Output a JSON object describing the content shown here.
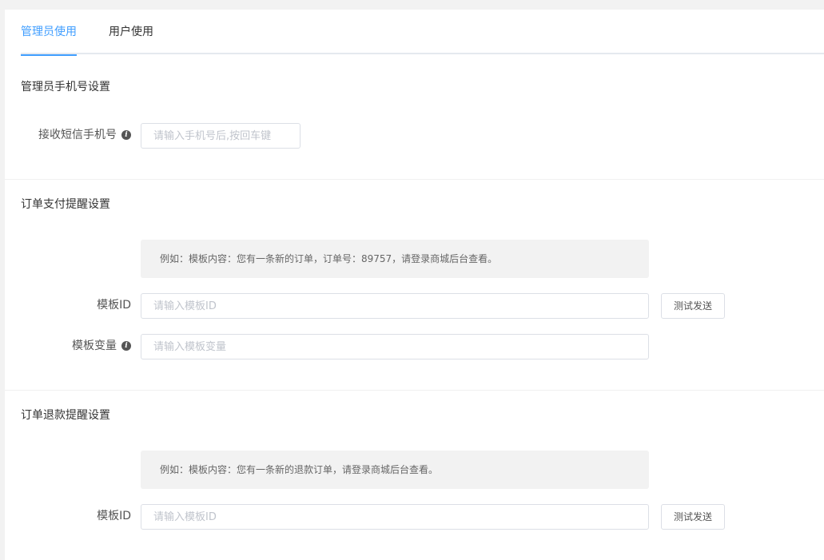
{
  "tabs": [
    {
      "label": "管理员使用",
      "active": true
    },
    {
      "label": "用户使用",
      "active": false
    }
  ],
  "admin_phone": {
    "section_title": "管理员手机号设置",
    "phone_label": "接收短信手机号",
    "phone_placeholder": "请输入手机号后,按回车键",
    "phone_value": ""
  },
  "order_pay": {
    "section_title": "订单支付提醒设置",
    "hint": "例如：模板内容：您有一条新的订单，订单号：89757，请登录商城后台查看。",
    "template_id_label": "模板ID",
    "template_id_placeholder": "请输入模板ID",
    "template_id_value": "",
    "test_button": "测试发送",
    "template_var_label": "模板变量",
    "template_var_placeholder": "请输入模板变量",
    "template_var_value": ""
  },
  "order_refund": {
    "section_title": "订单退款提醒设置",
    "hint": "例如：模板内容：您有一条新的退款订单，请登录商城后台查看。",
    "template_id_label": "模板ID",
    "template_id_placeholder": "请输入模板ID",
    "template_id_value": "",
    "test_button": "测试发送"
  },
  "colors": {
    "accent": "#409eff",
    "background": "#f2f2f2",
    "hint_background": "#f2f2f2",
    "border": "#dcdfe6"
  },
  "icons": {
    "info": "info-icon"
  }
}
